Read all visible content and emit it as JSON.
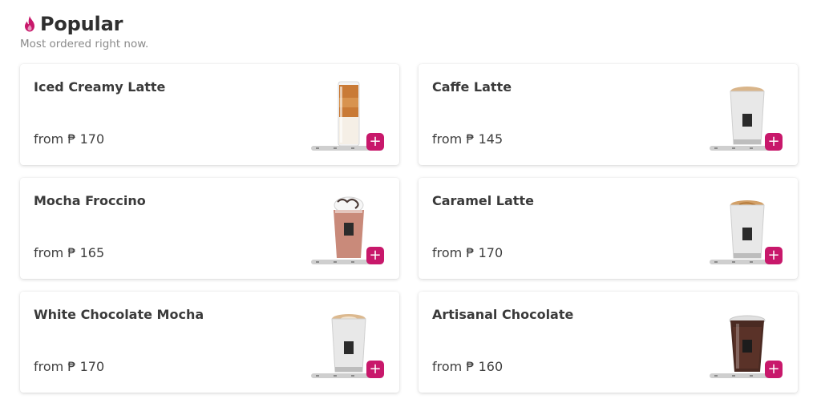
{
  "header": {
    "title": "Popular",
    "subtitle": "Most ordered right now.",
    "icon": "fire-icon",
    "accent": "#c8186b"
  },
  "products": [
    {
      "name": "Iced Creamy Latte",
      "price": "from ₱ 170",
      "image": "iced-latte-glass",
      "add": "+"
    },
    {
      "name": "Caffe Latte",
      "price": "from ₱ 145",
      "image": "hot-latte-cup",
      "add": "+"
    },
    {
      "name": "Mocha Froccino",
      "price": "from ₱ 165",
      "image": "frappe-cup",
      "add": "+"
    },
    {
      "name": "Caramel Latte",
      "price": "from ₱ 170",
      "image": "caramel-latte-cup",
      "add": "+"
    },
    {
      "name": "White Chocolate Mocha",
      "price": "from ₱ 170",
      "image": "white-mocha-cup",
      "add": "+"
    },
    {
      "name": "Artisanal Chocolate",
      "price": "from ₱ 160",
      "image": "iced-chocolate-cup",
      "add": "+"
    }
  ]
}
